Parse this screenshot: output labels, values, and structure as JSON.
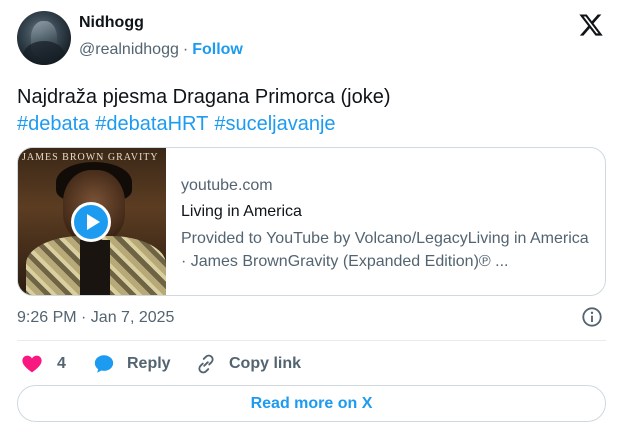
{
  "author": {
    "name": "Nidhogg",
    "handle": "@realnidhogg",
    "separator": "·",
    "follow_label": "Follow"
  },
  "tweet": {
    "text": "Najdraža pjesma Dragana Primorca (joke)",
    "hashtags": [
      "#debata",
      "#debataHRT",
      "#suceljavanje"
    ]
  },
  "link_card": {
    "thumbnail_caption": "JAMES BROWN GRAVITY",
    "domain": "youtube.com",
    "title": "Living in America",
    "description": "Provided to YouTube by Volcano/LegacyLiving in America · James BrownGravity (Expanded Edition)℗ ..."
  },
  "timestamp": "9:26 PM · Jan 7, 2025",
  "actions": {
    "like_count": "4",
    "reply_label": "Reply",
    "copy_link_label": "Copy link"
  },
  "read_more_label": "Read more on X",
  "colors": {
    "accent": "#1d9bf0",
    "like": "#f91880",
    "text_primary": "#0f1419",
    "text_secondary": "#536471",
    "border": "#cfd9de"
  },
  "icons": [
    "x-logo-icon",
    "play-icon",
    "info-icon",
    "heart-icon",
    "reply-bubble-icon",
    "link-icon"
  ]
}
